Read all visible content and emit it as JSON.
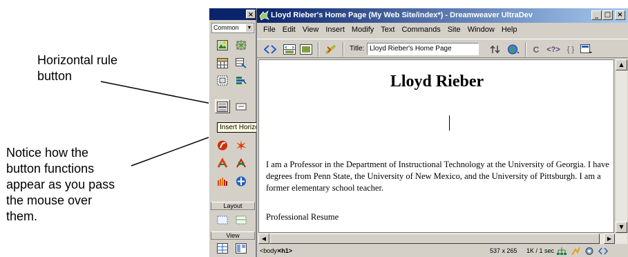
{
  "annotations": {
    "hr_button_label": [
      "Horizontal rule",
      "button"
    ],
    "notice_text": [
      "Notice how the",
      "button functions",
      "appear as you pass",
      "the mouse over",
      "them."
    ]
  },
  "palette": {
    "close_glyph": "×",
    "category": "Common",
    "sections": {
      "layout": "Layout",
      "view": "View"
    },
    "tooltip": "Insert Horizontal Rule"
  },
  "window": {
    "title": "Lloyd Rieber's Home Page (My Web Site/index*) - Dreamweaver UltraDev",
    "controls": {
      "minimize": "_",
      "maximize": "□",
      "close": "×"
    }
  },
  "menu": [
    "File",
    "Edit",
    "View",
    "Insert",
    "Modify",
    "Text",
    "Commands",
    "Site",
    "Window",
    "Help"
  ],
  "toolbar": {
    "title_label": "Title:",
    "title_value": "Lloyd Rieber's Home Page",
    "code_symbols": {
      "refresh": "C",
      "code_nav": "<?>",
      "braces": "{ }"
    }
  },
  "document": {
    "heading": "Lloyd Rieber",
    "paragraph": "I am a Professor in the Department of Instructional Technology at the University of Georgia. I have degrees from Penn State, the University of New Mexico, and the University of Pittsburgh. I am a former elementary school teacher.",
    "resume": "Professional Resume"
  },
  "status": {
    "tag_body": "<body>",
    "tag_h1": "<h1>",
    "window_size": "537 x 265",
    "download": "1K / 1 sec"
  },
  "colors": {
    "title_bar": "#0a246a",
    "chrome": "#d4d0c8",
    "tooltip": "#ffffe1"
  }
}
